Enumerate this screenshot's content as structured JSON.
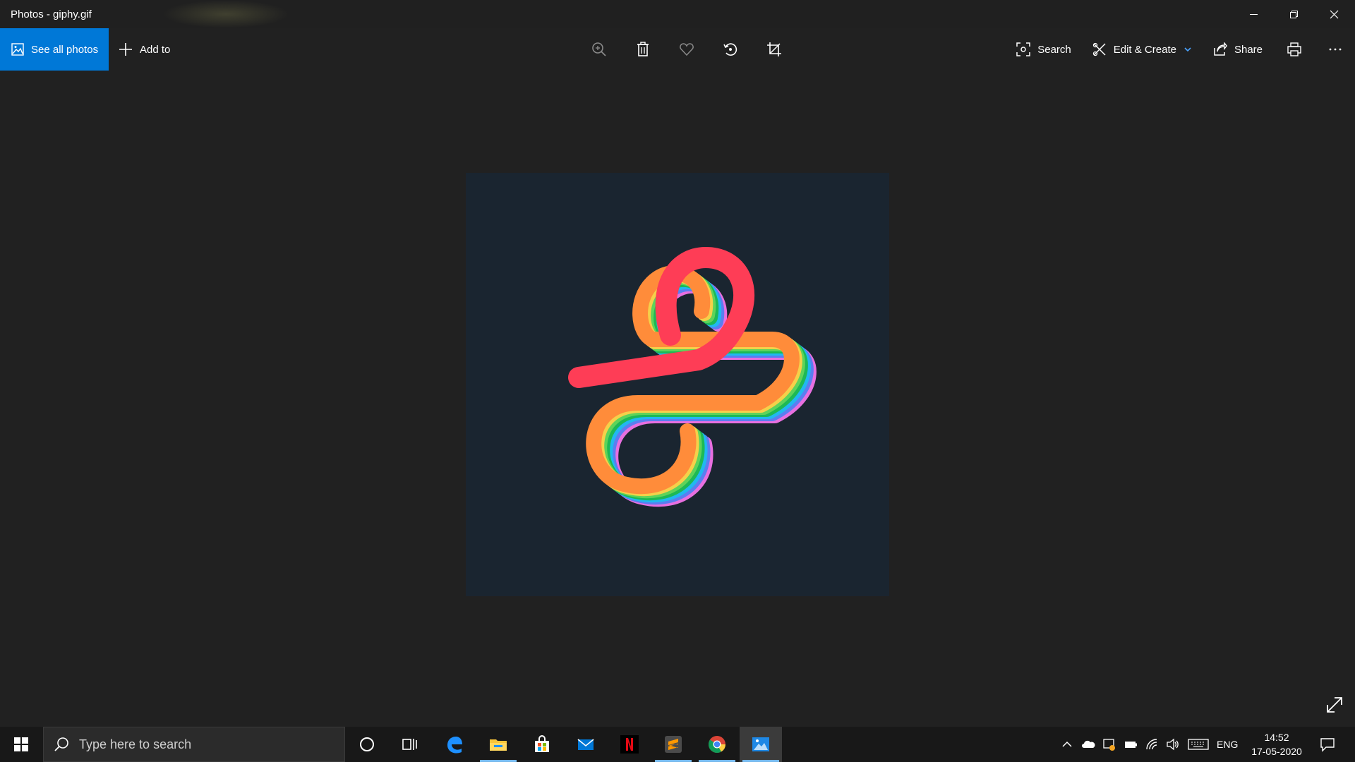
{
  "window": {
    "title": "Photos - giphy.gif",
    "controls": [
      "minimize-icon",
      "restore-icon",
      "close-icon"
    ]
  },
  "toolbar": {
    "see_all_label": "See all photos",
    "add_to_label": "Add to",
    "center_tools": [
      "zoom-icon",
      "delete-icon",
      "heart-icon",
      "rotate-icon",
      "crop-icon"
    ],
    "search_label": "Search",
    "edit_create_label": "Edit & Create",
    "share_label": "Share",
    "accent_color": "#0078d7"
  },
  "image": {
    "background_color": "#1a2530",
    "stripe_colors": [
      "#fe3d56",
      "#ff8c3a",
      "#f5d04a",
      "#5ed35a",
      "#1db954",
      "#21b8f0",
      "#5b7ef0",
      "#e86fe0"
    ]
  },
  "taskbar": {
    "search_placeholder": "Type here to search",
    "pinned": [
      "cortana-icon",
      "task-view-icon",
      "edge-icon",
      "file-explorer-icon",
      "store-icon",
      "mail-icon",
      "netflix-icon",
      "sublime-text-icon",
      "chrome-icon",
      "photos-icon"
    ],
    "language": "ENG",
    "time": "14:52",
    "date": "17-05-2020"
  }
}
